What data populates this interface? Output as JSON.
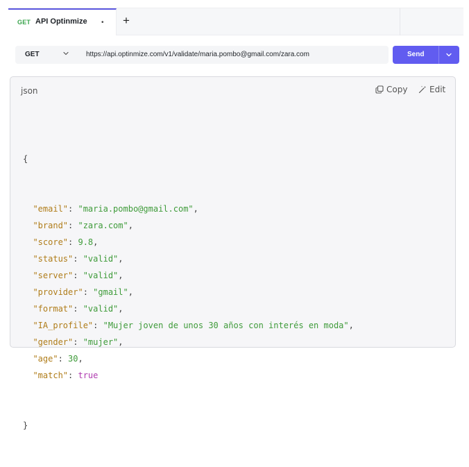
{
  "tab": {
    "method": "GET",
    "title": "API Optinmize",
    "dot": "•",
    "add_label": "+"
  },
  "request": {
    "method": "GET",
    "url": "https://api.optinmize.com/v1/validate/maria.pombo@gmail.com/zara.com",
    "send_label": "Send"
  },
  "response": {
    "language": "json",
    "copy_label": "Copy",
    "edit_label": "Edit",
    "open_brace": "{",
    "close_brace": "}",
    "fields": [
      {
        "key": "\"email\"",
        "value": "\"maria.pombo@gmail.com\"",
        "type": "string"
      },
      {
        "key": "\"brand\"",
        "value": "\"zara.com\"",
        "type": "string"
      },
      {
        "key": "\"score\"",
        "value": "9.8",
        "type": "number"
      },
      {
        "key": "\"status\"",
        "value": "\"valid\"",
        "type": "string"
      },
      {
        "key": "\"server\"",
        "value": "\"valid\"",
        "type": "string"
      },
      {
        "key": "\"provider\"",
        "value": "\"gmail\"",
        "type": "string"
      },
      {
        "key": "\"format\"",
        "value": "\"valid\"",
        "type": "string"
      },
      {
        "key": "\"IA_profile\"",
        "value": "\"Mujer joven de unos 30 años con interés en moda\"",
        "type": "string"
      },
      {
        "key": "\"gender\"",
        "value": "\"mujer\"",
        "type": "string"
      },
      {
        "key": "\"age\"",
        "value": "30",
        "type": "number"
      },
      {
        "key": "\"match\"",
        "value": "true",
        "type": "boolean"
      }
    ]
  },
  "colors": {
    "accent": "#615cf0",
    "method_green": "#3aa44d",
    "json_key": "#b07d1a",
    "json_string": "#3f9b3a",
    "json_boolean": "#b03cb0"
  },
  "icons": {
    "method_dropdown": "chevron-down-icon",
    "send_dropdown": "chevron-down-icon",
    "copy": "copy-icon",
    "edit": "magic-wand-icon"
  }
}
